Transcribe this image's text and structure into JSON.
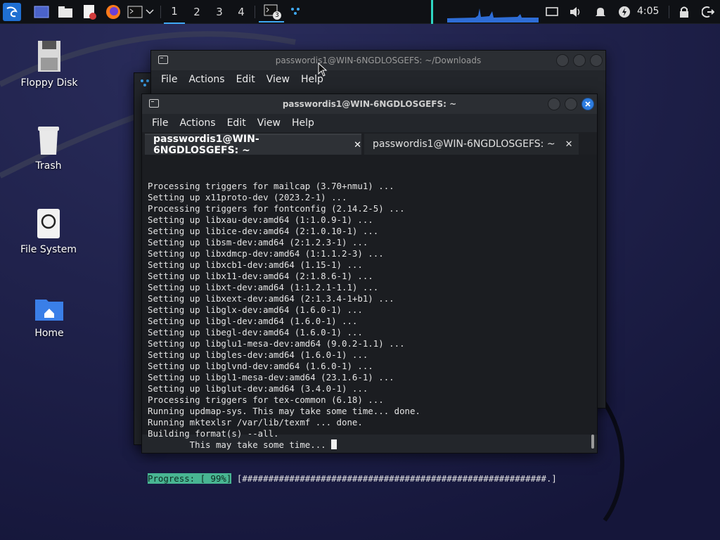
{
  "panel": {
    "workspaces": [
      "1",
      "2",
      "3",
      "4"
    ],
    "terminal_badge": "3",
    "clock": "4:05",
    "accent": "#3fa9f5"
  },
  "desktop": {
    "icons": [
      {
        "label": "Floppy Disk",
        "icon": "floppy-disk-icon"
      },
      {
        "label": "Trash",
        "icon": "trash-icon"
      },
      {
        "label": "File System",
        "icon": "hard-drive-icon"
      },
      {
        "label": "Home",
        "icon": "home-folder-icon"
      }
    ]
  },
  "back_window": {
    "title": "passwordis1@WIN-6NGDLOSGEFS: ~/Downloads",
    "menu": [
      "File",
      "Actions",
      "Edit",
      "View",
      "Help"
    ]
  },
  "front_window": {
    "title": "passwordis1@WIN-6NGDLOSGEFS: ~",
    "menu": [
      "File",
      "Actions",
      "Edit",
      "View",
      "Help"
    ],
    "tabs": [
      {
        "label": "passwordis1@WIN-6NGDLOSGEFS: ~",
        "close": "✕"
      },
      {
        "label": "passwordis1@WIN-6NGDLOSGEFS: ~",
        "close": "✕"
      }
    ],
    "terminal_lines": [
      "Processing triggers for mailcap (3.70+nmu1) ...",
      "Setting up x11proto-dev (2023.2-1) ...",
      "Processing triggers for fontconfig (2.14.2-5) ...",
      "Setting up libxau-dev:amd64 (1:1.0.9-1) ...",
      "Setting up libice-dev:amd64 (2:1.0.10-1) ...",
      "Setting up libsm-dev:amd64 (2:1.2.3-1) ...",
      "Setting up libxdmcp-dev:amd64 (1:1.1.2-3) ...",
      "Setting up libxcb1-dev:amd64 (1.15-1) ...",
      "Setting up libx11-dev:amd64 (2:1.8.6-1) ...",
      "Setting up libxt-dev:amd64 (1:1.2.1-1.1) ...",
      "Setting up libxext-dev:amd64 (2:1.3.4-1+b1) ...",
      "Setting up libglx-dev:amd64 (1.6.0-1) ...",
      "Setting up libgl-dev:amd64 (1.6.0-1) ...",
      "Setting up libegl-dev:amd64 (1.6.0-1) ...",
      "Setting up libglu1-mesa-dev:amd64 (9.0.2-1.1) ...",
      "Setting up libgles-dev:amd64 (1.6.0-1) ...",
      "Setting up libglvnd-dev:amd64 (1.6.0-1) ...",
      "Setting up libgl1-mesa-dev:amd64 (23.1.6-1) ...",
      "Setting up libglut-dev:amd64 (3.4.0-1) ...",
      "Processing triggers for tex-common (6.18) ...",
      "Running updmap-sys. This may take some time... done.",
      "Running mktexlsr /var/lib/texmf ... done.",
      "Building format(s) --all.",
      "        This may take some time... "
    ],
    "progress_label": "Progress: [ 99%]",
    "progress_bar": " [##########################################################.]",
    "progress_percent": 99
  }
}
